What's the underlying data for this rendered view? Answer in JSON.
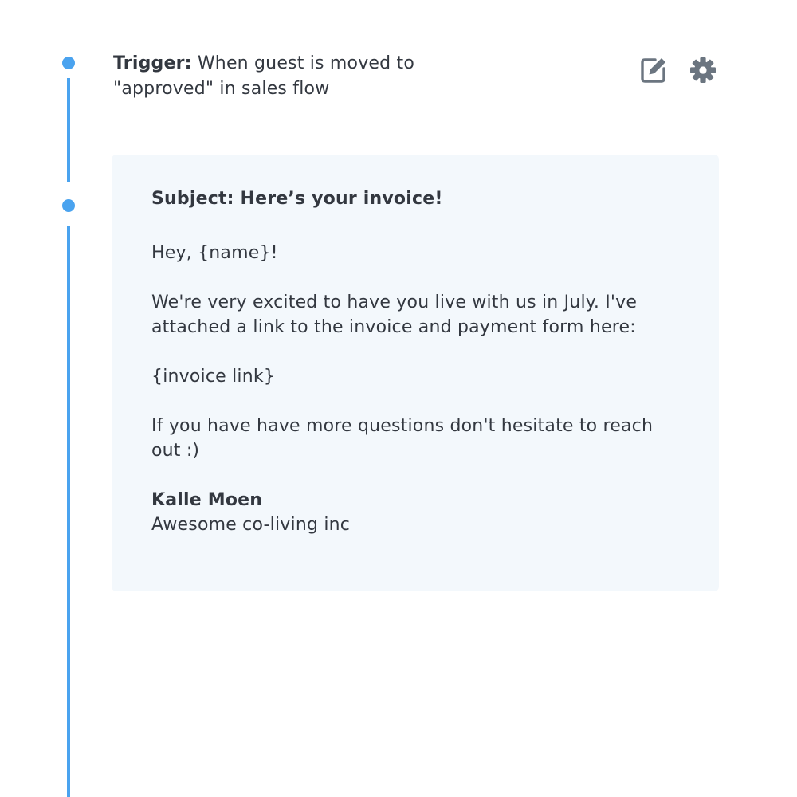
{
  "trigger": {
    "label": "Trigger:",
    "text": " When guest is moved to \"approved\" in sales flow"
  },
  "actions": {
    "edit_icon": "edit-icon",
    "settings_icon": "gear-icon",
    "icon_color": "#6b7580"
  },
  "timeline": {
    "accent_color": "#4aa3ef"
  },
  "email": {
    "subject": "Subject: Here’s your invoice!",
    "greeting": "Hey, {name}!",
    "body_1": "We're very excited to have you live with us in July. I've attached a link to the invoice and payment form here:",
    "invoice_link": "{invoice link}",
    "body_2": "If you have have more questions don't hesitate to reach out :)",
    "signature_name": "Kalle Moen",
    "signature_company": "Awesome co-living inc",
    "background_color": "#f3f8fc"
  }
}
